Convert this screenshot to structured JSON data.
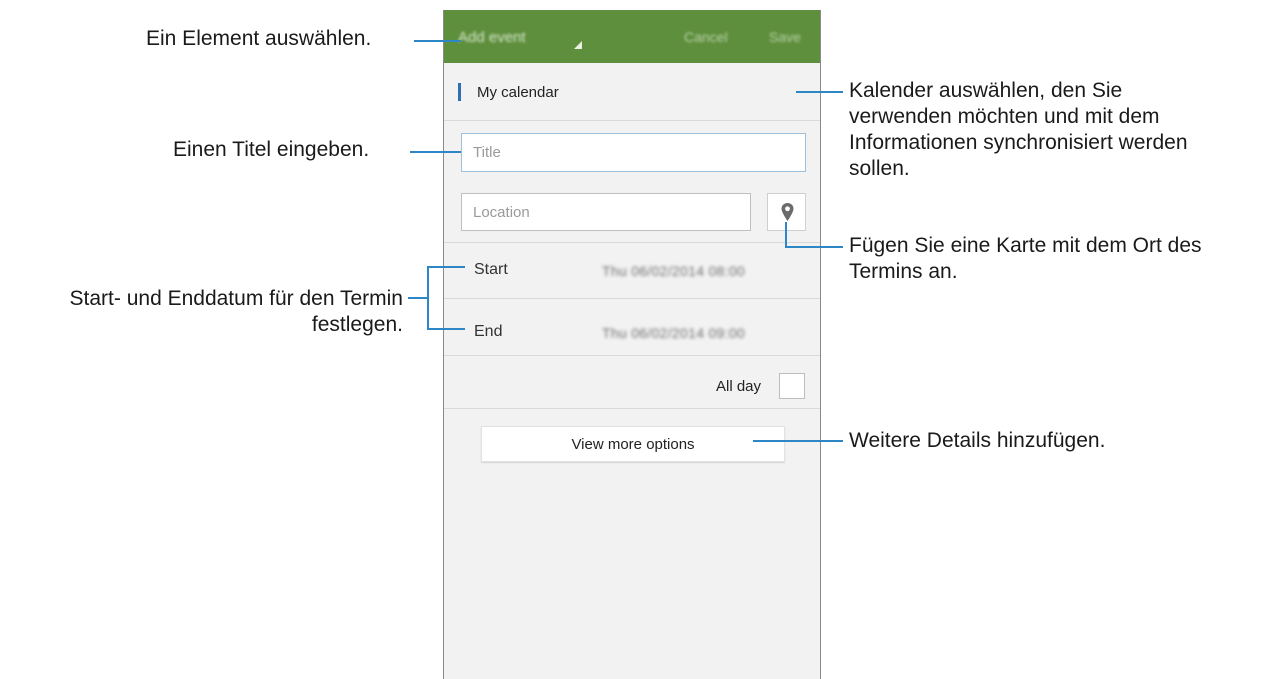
{
  "app": {
    "actionbar": {
      "title": "Add event",
      "cancel": "Cancel",
      "save": "Save",
      "color": "#5e8f3c"
    },
    "calendar": {
      "name": "My calendar",
      "color": "#2f6fae"
    },
    "title_field": {
      "placeholder": "Title"
    },
    "location_field": {
      "placeholder": "Location",
      "icon": "map-pin-icon"
    },
    "start": {
      "label": "Start",
      "value": "Thu 06/02/2014  08:00"
    },
    "end": {
      "label": "End",
      "value": "Thu 06/02/2014  09:00"
    },
    "all_day": {
      "label": "All day",
      "checked": false
    },
    "more_options": "View more options"
  },
  "annotations": {
    "select_item": "Ein Element auswählen.",
    "enter_title": "Einen Titel eingeben.",
    "set_dates": [
      "Start- und Enddatum für den Termin",
      "festlegen."
    ],
    "select_calendar": [
      "Kalender auswählen, den Sie",
      "verwenden möchten und mit dem",
      "Informationen synchronisiert werden",
      "sollen."
    ],
    "add_map": [
      "Fügen Sie eine Karte mit dem Ort des",
      "Termins an."
    ],
    "more_details": "Weitere Details hinzufügen.",
    "line_color": "#2d86c5"
  }
}
